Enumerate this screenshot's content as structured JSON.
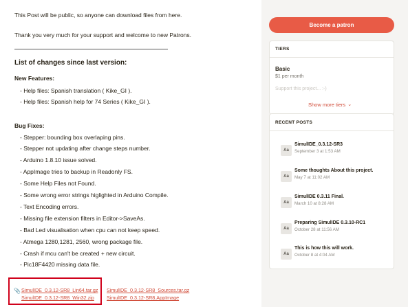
{
  "post": {
    "intro_1": "This Post will be public, so anyone can download files from here.",
    "intro_2": "Thank you very much for your support and welcome to new Patrons.",
    "changes_heading": "List of changes since last version:",
    "features_heading": "New Features:",
    "features": [
      "- Help files: Spanish translation ( Kike_GI ).",
      "- Help files: Spanish help for 74 Series ( Kike_GI )."
    ],
    "bugfix_heading": "Bug Fixes:",
    "bugfixes": [
      "- Stepper: bounding box overlaping pins.",
      "- Stepper not updating after change steps number.",
      "- Arduino 1.8.10 issue solved.",
      "- AppImage tries to backup in Readonly FS.",
      "- Some Help Files not Found.",
      "- Some wrong error strings higlighted in Arduino Compile.",
      "- Text Encoding errors.",
      "- Missing file extension filters in Editor->SaveAs.",
      "- Bad Led visualisation when cpu can not keep speed.",
      "- Atmega 1280,1281, 2560, wrong package file.",
      "- Crash if mcu can't be created + new circuit.",
      "- Pic18F4420 missing data file."
    ],
    "attachments": [
      "SimulIDE_0.3.12-SR8_Lin64.tar.gz",
      "SimulIDE_0.3.12-SR8_Sources.tar.gz",
      "SimulIDE_0.3.12-SR8_Win32.zip",
      "SimulIDE_0.3.12-SR8.AppImage"
    ]
  },
  "sidebar": {
    "become_button": "Become a patron",
    "tiers_title": "TIERS",
    "tier": {
      "name": "Basic",
      "price": "$1 per month",
      "description": "Support this project... :-)"
    },
    "show_more": "Show more tiers",
    "recent_title": "RECENT POSTS",
    "recent_posts": [
      {
        "icon": "Aa",
        "title": "SimulIDE_0.3.12-SR3",
        "date": "September 3 at 1:53 AM"
      },
      {
        "icon": "Aa",
        "title": "Some thoughts About this project.",
        "date": "May 7 at 11:02 AM"
      },
      {
        "icon": "Aa",
        "title": "SimulIDE 0.3.11 Final.",
        "date": "March 10 at 8:28 AM"
      },
      {
        "icon": "Aa",
        "title": "Preparing SimulIDE 0.3.10-RC1",
        "date": "October 28 at 11:56 AM"
      },
      {
        "icon": "Aa",
        "title": "This is how this will work.",
        "date": "October 8 at 4:04 AM"
      }
    ]
  },
  "colors": {
    "accent": "#e85b46",
    "highlight_box": "#d0011b",
    "link": "#d04a37"
  }
}
